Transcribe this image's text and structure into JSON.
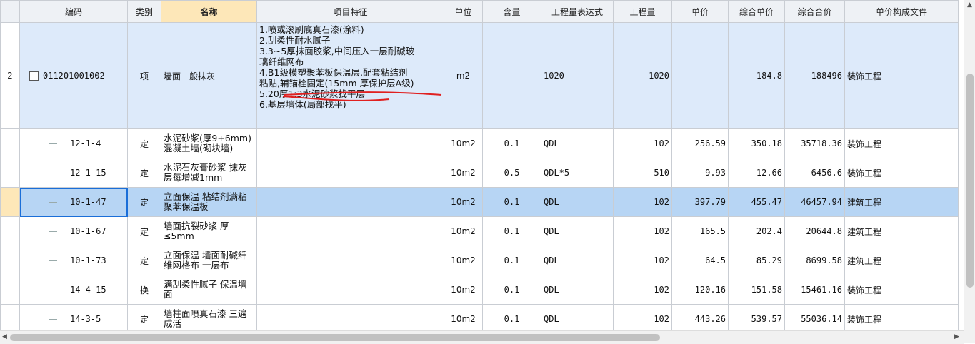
{
  "columns": [
    "编码",
    "类别",
    "名称",
    "项目特征",
    "单位",
    "含量",
    "工程量表达式",
    "工程量",
    "单价",
    "综合单价",
    "综合合价",
    "单价构成文件"
  ],
  "main_row": {
    "row_no": "2",
    "code": "011201001002",
    "category": "项",
    "name": "墙面一般抹灰",
    "features": [
      "1.喷或滚刷底真石漆(涂料)",
      "2.刮柔性耐水腻子",
      "3.3~5厚抹面胶浆,中间压入一层耐碱玻",
      "璃纤维网布",
      "4.B1级模塑聚苯板保温层,配套粘结剂",
      "粘贴,辅锚栓固定(15mm 厚保护层A级)",
      "5.20厚1:3水泥砂浆找平层",
      "6.基层墙体(局部找平)"
    ],
    "unit": "m2",
    "content": "",
    "expr": "1020",
    "qty": "1020",
    "price": "",
    "unit_price": "184.8",
    "total": "188496",
    "file": "装饰工程"
  },
  "rows": [
    {
      "code": "12-1-4",
      "category": "定",
      "name": "水泥砂浆(厚9+6mm)混凝土墙(砌块墙)",
      "unit": "10m2",
      "content": "0.1",
      "expr": "QDL",
      "qty": "102",
      "price": "256.59",
      "unit_price": "350.18",
      "total": "35718.36",
      "file": "装饰工程"
    },
    {
      "code": "12-1-15",
      "category": "定",
      "name": "水泥石灰膏砂浆 抹灰层每增减1mm",
      "unit": "10m2",
      "content": "0.5",
      "expr": "QDL*5",
      "qty": "510",
      "price": "9.93",
      "unit_price": "12.66",
      "total": "6456.6",
      "file": "装饰工程"
    },
    {
      "code": "10-1-47",
      "category": "定",
      "name": "立面保温 粘结剂满粘聚苯保温板",
      "unit": "10m2",
      "content": "0.1",
      "expr": "QDL",
      "qty": "102",
      "price": "397.79",
      "unit_price": "455.47",
      "total": "46457.94",
      "file": "建筑工程",
      "selected": true
    },
    {
      "code": "10-1-67",
      "category": "定",
      "name": "墙面抗裂砂浆 厚≤5mm",
      "unit": "10m2",
      "content": "0.1",
      "expr": "QDL",
      "qty": "102",
      "price": "165.5",
      "unit_price": "202.4",
      "total": "20644.8",
      "file": "建筑工程"
    },
    {
      "code": "10-1-73",
      "category": "定",
      "name": "立面保温 墙面耐碱纤维网格布 一层布",
      "unit": "10m2",
      "content": "0.1",
      "expr": "QDL",
      "qty": "102",
      "price": "64.5",
      "unit_price": "85.29",
      "total": "8699.58",
      "file": "建筑工程"
    },
    {
      "code": "14-4-15",
      "category": "换",
      "name": "满刮柔性腻子 保温墙面",
      "unit": "10m2",
      "content": "0.1",
      "expr": "QDL",
      "qty": "102",
      "price": "120.16",
      "unit_price": "151.58",
      "total": "15461.16",
      "file": "装饰工程"
    },
    {
      "code": "14-3-5",
      "category": "定",
      "name": "墙柱面喷真石漆 三遍成活",
      "unit": "10m2",
      "content": "0.1",
      "expr": "QDL",
      "qty": "102",
      "price": "443.26",
      "unit_price": "539.57",
      "total": "55036.14",
      "file": "装饰工程"
    }
  ],
  "colors": {
    "header_bg": "#eef1f5",
    "header_highlight": "#fde7b8",
    "main_row_bg": "#ddeafa",
    "selected_bg": "#b7d5f4",
    "selection_border": "#1a6ed8",
    "annotation": "#e02020"
  }
}
